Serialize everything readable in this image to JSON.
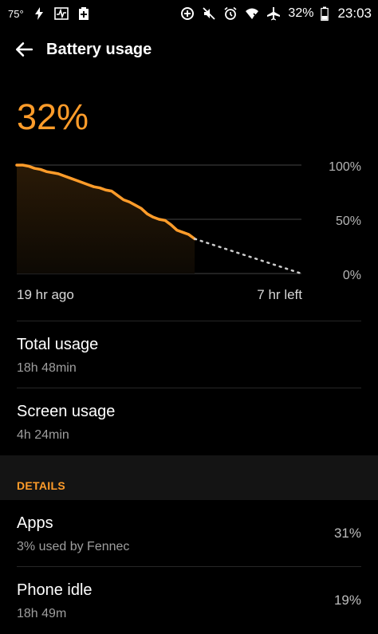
{
  "status_bar": {
    "temperature": "75°",
    "battery_percent": "32%",
    "time": "23:03",
    "icons": [
      "flash-icon",
      "activity-icon",
      "battery-add-icon",
      "data-saver-icon",
      "mute-icon",
      "alarm-icon",
      "wifi-icon",
      "airplane-icon",
      "battery-icon"
    ]
  },
  "header": {
    "title": "Battery usage"
  },
  "summary": {
    "level": "32%"
  },
  "chart_data": {
    "type": "line",
    "yticks": [
      "100%",
      "50%",
      "0%"
    ],
    "ylim": [
      0,
      100
    ],
    "xlabels": {
      "start": "19 hr ago",
      "end": "7 hr left"
    },
    "series": [
      {
        "values": [
          [
            0,
            100
          ],
          [
            1,
            100
          ],
          [
            2,
            99
          ],
          [
            3,
            97
          ],
          [
            4,
            96
          ],
          [
            5,
            94
          ],
          [
            6,
            93
          ],
          [
            7,
            92
          ],
          [
            8,
            90
          ],
          [
            9,
            88
          ],
          [
            10,
            86
          ],
          [
            11,
            84
          ],
          [
            12,
            82
          ],
          [
            13,
            80
          ],
          [
            14,
            79
          ],
          [
            15,
            77
          ],
          [
            16,
            76
          ],
          [
            17,
            72
          ],
          [
            18,
            68
          ],
          [
            19,
            66
          ],
          [
            20,
            63
          ],
          [
            21,
            60
          ],
          [
            22,
            55
          ],
          [
            23,
            52
          ],
          [
            24,
            50
          ],
          [
            25,
            49
          ],
          [
            26,
            45
          ],
          [
            27,
            40
          ],
          [
            28,
            38
          ],
          [
            29,
            36
          ],
          [
            30,
            32
          ]
        ]
      },
      {
        "values": [
          [
            30,
            32
          ],
          [
            48,
            0
          ]
        ]
      }
    ],
    "colors": {
      "line": "#ff9c2a",
      "projection": "#cccccc",
      "fill": "#2a1a06",
      "grid": "#444444"
    }
  },
  "usage": {
    "total": {
      "label": "Total usage",
      "value": "18h 48min"
    },
    "screen": {
      "label": "Screen usage",
      "value": "4h 24min"
    }
  },
  "details": {
    "header": "DETAILS",
    "items": [
      {
        "label": "Apps",
        "sublabel": "3% used by Fennec",
        "value": "31%"
      },
      {
        "label": "Phone idle",
        "sublabel": "18h 49m",
        "value": "19%"
      }
    ]
  }
}
